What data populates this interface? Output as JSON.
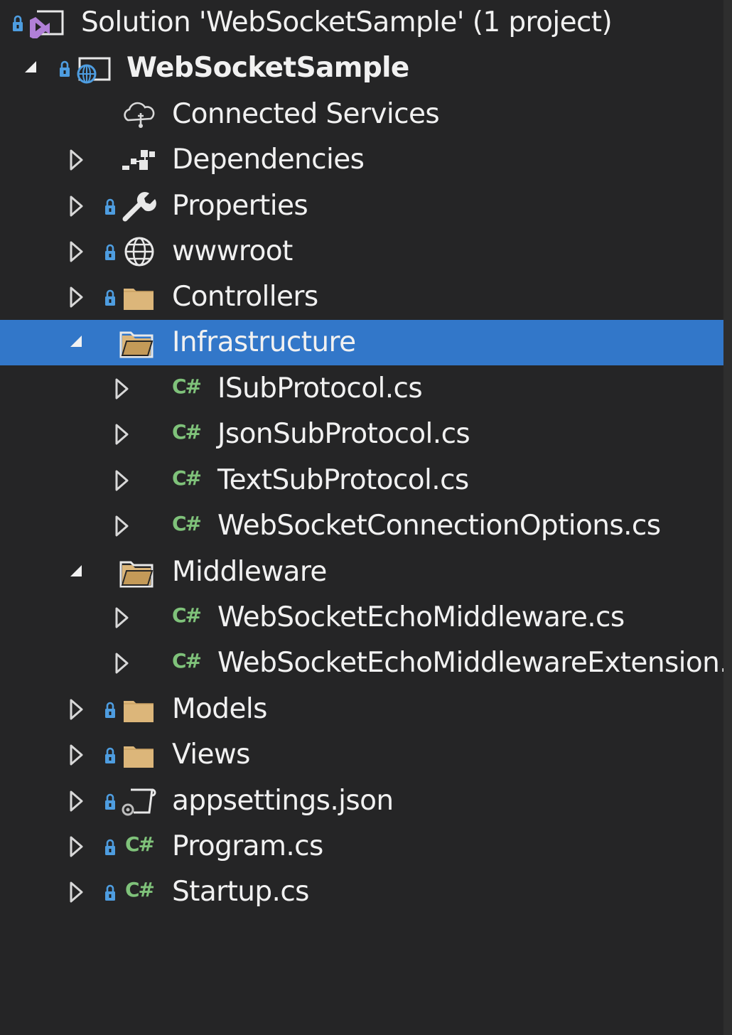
{
  "panel": {
    "name": "solution-explorer",
    "colors": {
      "background": "#252526",
      "selection": "#3277c9",
      "text": "#f1f1f1",
      "folder": "#dcb67a",
      "csharp": "#7fc27a",
      "lock": "#4e9de0",
      "solution": "#b180d7"
    }
  },
  "tree": {
    "solution": {
      "label": "Solution 'WebSocketSample' (1 project)",
      "icon": "visual-studio-solution-icon"
    },
    "project": {
      "label": "WebSocketSample",
      "icon": "web-project-icon",
      "expanded": true
    },
    "connected_services": {
      "label": "Connected Services",
      "icon": "cloud-service-icon"
    },
    "dependencies": {
      "label": "Dependencies",
      "icon": "dependencies-icon"
    },
    "properties": {
      "label": "Properties",
      "icon": "wrench-icon"
    },
    "wwwroot": {
      "label": "wwwroot",
      "icon": "globe-icon"
    },
    "controllers": {
      "label": "Controllers",
      "icon": "folder-icon"
    },
    "infrastructure": {
      "label": "Infrastructure",
      "icon": "folder-open-icon",
      "expanded": true,
      "selected": true,
      "files": [
        {
          "label": "ISubProtocol.cs",
          "badge": "C#"
        },
        {
          "label": "JsonSubProtocol.cs",
          "badge": "C#"
        },
        {
          "label": "TextSubProtocol.cs",
          "badge": "C#"
        },
        {
          "label": "WebSocketConnectionOptions.cs",
          "badge": "C#"
        }
      ]
    },
    "middleware": {
      "label": "Middleware",
      "icon": "folder-open-icon",
      "expanded": true,
      "files": [
        {
          "label": "WebSocketEchoMiddleware.cs",
          "badge": "C#"
        },
        {
          "label": "WebSocketEchoMiddlewareExtension.cs",
          "badge": "C#"
        }
      ]
    },
    "models": {
      "label": "Models",
      "icon": "folder-icon"
    },
    "views": {
      "label": "Views",
      "icon": "folder-icon"
    },
    "appsettings": {
      "label": "appsettings.json",
      "icon": "json-settings-icon"
    },
    "program": {
      "label": "Program.cs",
      "badge": "C#"
    },
    "startup": {
      "label": "Startup.cs",
      "badge": "C#"
    }
  }
}
